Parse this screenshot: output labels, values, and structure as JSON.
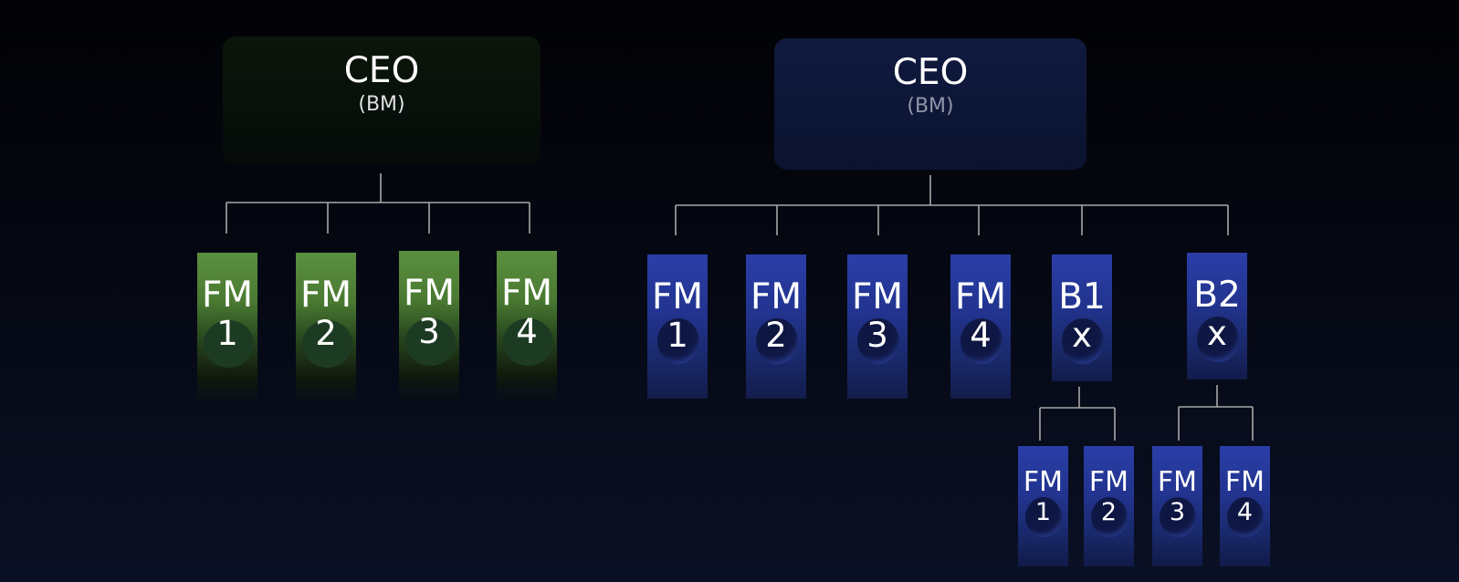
{
  "left_chart": {
    "root": {
      "title": "CEO",
      "subtitle": "(BM)"
    },
    "nodes": [
      {
        "line1": "FM",
        "line2": "1"
      },
      {
        "line1": "FM",
        "line2": "2"
      },
      {
        "line1": "FM",
        "line2": "3"
      },
      {
        "line1": "FM",
        "line2": "4"
      }
    ]
  },
  "right_chart": {
    "root": {
      "title": "CEO",
      "subtitle": "(BM)"
    },
    "nodes": [
      {
        "line1": "FM",
        "line2": "1"
      },
      {
        "line1": "FM",
        "line2": "2"
      },
      {
        "line1": "FM",
        "line2": "3"
      },
      {
        "line1": "FM",
        "line2": "4"
      },
      {
        "line1": "B1",
        "line2": "x"
      },
      {
        "line1": "B2",
        "line2": "x"
      }
    ],
    "b1_children": [
      {
        "line1": "FM",
        "line2": "1"
      },
      {
        "line1": "FM",
        "line2": "2"
      }
    ],
    "b2_children": [
      {
        "line1": "FM",
        "line2": "3"
      },
      {
        "line1": "FM",
        "line2": "4"
      }
    ]
  },
  "colors": {
    "green_node": "#4a7a32",
    "blue_node": "#22348f",
    "connector": "#a8a8a8",
    "background": "#050812"
  }
}
